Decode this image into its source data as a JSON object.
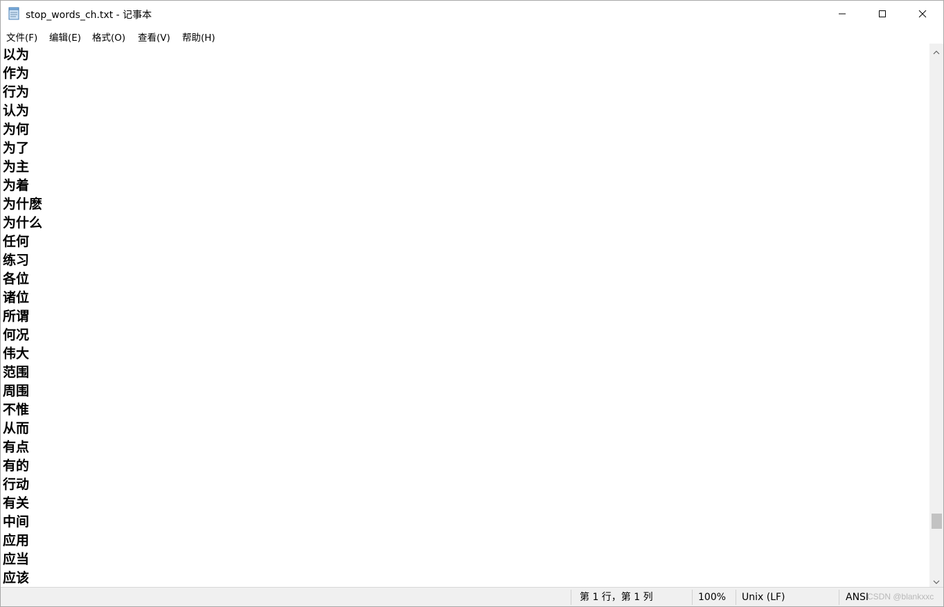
{
  "window": {
    "title": "stop_words_ch.txt - 记事本"
  },
  "menu": [
    {
      "label": "文件(F)"
    },
    {
      "label": "编辑(E)"
    },
    {
      "label": "格式(O)"
    },
    {
      "label": "查看(V)"
    },
    {
      "label": "帮助(H)"
    }
  ],
  "editor": {
    "lines": [
      "以为",
      "作为",
      "行为",
      "认为",
      "为何",
      "为了",
      "为主",
      "为着",
      "为什麽",
      "为什么",
      "任何",
      "练习",
      "各位",
      "诸位",
      "所谓",
      "何况",
      "伟大",
      "范围",
      "周围",
      "不惟",
      "从而",
      "有点",
      "有的",
      "行动",
      "有关",
      "中间",
      "应用",
      "应当",
      "应该"
    ]
  },
  "status": {
    "position": "第 1 行，第 1 列",
    "zoom": "100%",
    "line_ending": "Unix (LF)",
    "encoding": "ANSI"
  },
  "watermark": "CSDN @blankxxc"
}
